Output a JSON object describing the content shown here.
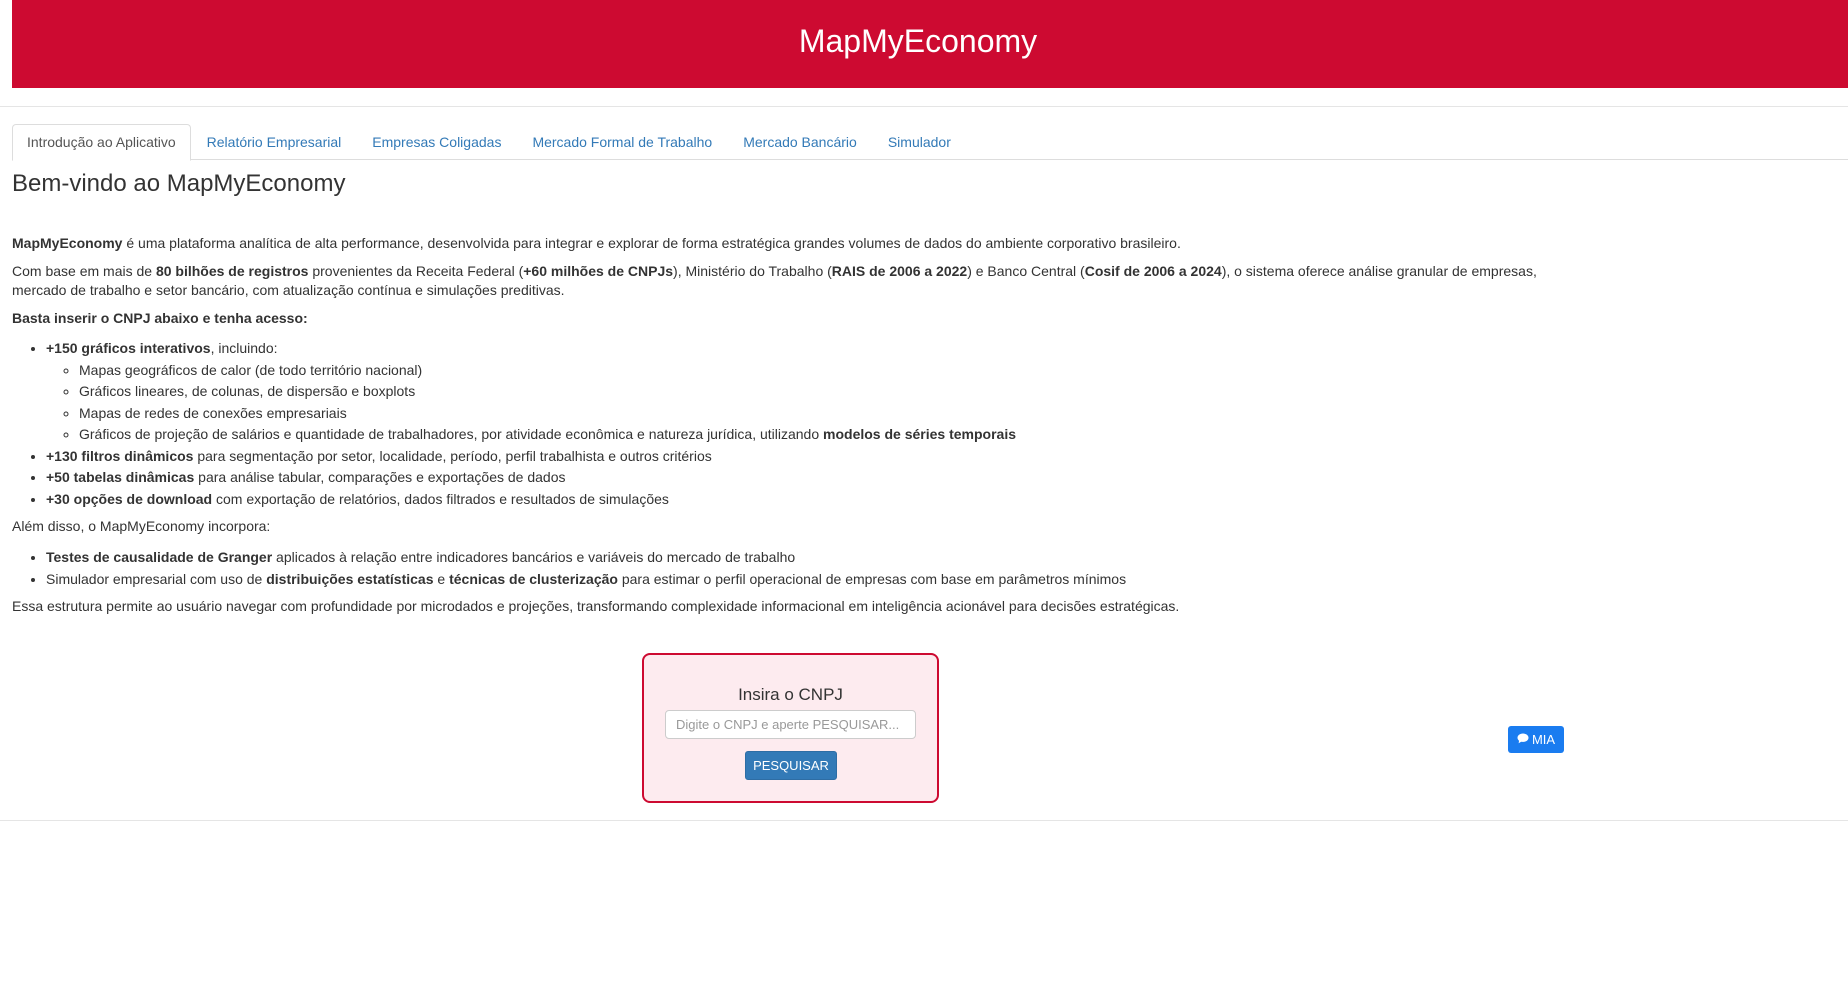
{
  "header": {
    "title": "MapMyEconomy"
  },
  "colors": {
    "brand_red": "#cd0a31",
    "link_blue": "#337ab7",
    "search_bg": "#fdebef",
    "mia_blue": "#1a7cf0"
  },
  "tabs": [
    {
      "label": "Introdução ao Aplicativo",
      "active": true
    },
    {
      "label": "Relatório Empresarial"
    },
    {
      "label": "Empresas Coligadas"
    },
    {
      "label": "Mercado Formal de Trabalho"
    },
    {
      "label": "Mercado Bancário"
    },
    {
      "label": "Simulador"
    }
  ],
  "intro": {
    "heading": "Bem-vindo ao MapMyEconomy",
    "p1": {
      "b1": "MapMyEconomy",
      "t1": " é uma plataforma analítica de alta performance, desenvolvida para integrar e explorar de forma estratégica grandes volumes de dados do ambiente corporativo brasileiro."
    },
    "p2": {
      "t1": "Com base em mais de ",
      "b1": "80 bilhões de registros",
      "t2": " provenientes da Receita Federal (",
      "b2": "+60 milhões de CNPJs",
      "t3": "), Ministério do Trabalho (",
      "b3": "RAIS de 2006 a 2022",
      "t4": ") e Banco Central (",
      "b4": "Cosif de 2006 a 2024",
      "t5": "), o sistema oferece análise granular de empresas, mercado de trabalho e setor bancário, com atualização contínua e simulações preditivas."
    },
    "p3": "Basta inserir o CNPJ abaixo e tenha acesso:",
    "list1": {
      "i1": {
        "b": "+150 gráficos interativos",
        "t": ", incluindo:"
      },
      "sub": {
        "s1": "Mapas geográficos de calor (de todo território nacional)",
        "s2": "Gráficos lineares, de colunas, de dispersão e boxplots",
        "s3": "Mapas de redes de conexões empresariais",
        "s4": {
          "t": "Gráficos de projeção de salários e quantidade de trabalhadores, por atividade econômica e natureza jurídica, utilizando ",
          "b": "modelos de séries temporais"
        }
      },
      "i2": {
        "b": "+130 filtros dinâmicos",
        "t": " para segmentação por setor, localidade, período, perfil trabalhista e outros critérios"
      },
      "i3": {
        "b": "+50 tabelas dinâmicas",
        "t": " para análise tabular, comparações e exportações de dados"
      },
      "i4": {
        "b": "+30 opções de download",
        "t": " com exportação de relatórios, dados filtrados e resultados de simulações"
      }
    },
    "p4": "Além disso, o MapMyEconomy incorpora:",
    "list2": {
      "i1": {
        "b": "Testes de causalidade de Granger",
        "t": " aplicados à relação entre indicadores bancários e variáveis do mercado de trabalho"
      },
      "i2": {
        "t1": "Simulador empresarial com uso de ",
        "b1": "distribuições estatísticas",
        "t2": " e ",
        "b2": "técnicas de clusterização",
        "t3": " para estimar o perfil operacional de empresas com base em parâmetros mínimos"
      }
    },
    "p5": "Essa estrutura permite ao usuário navegar com profundidade por microdados e projeções, transformando complexidade informacional em inteligência acionável para decisões estratégicas."
  },
  "search": {
    "title": "Insira o CNPJ",
    "placeholder": "Digite o CNPJ e aperte PESQUISAR...",
    "button": "PESQUISAR"
  },
  "mia": {
    "label": "MIA",
    "icon": "comment-icon"
  }
}
